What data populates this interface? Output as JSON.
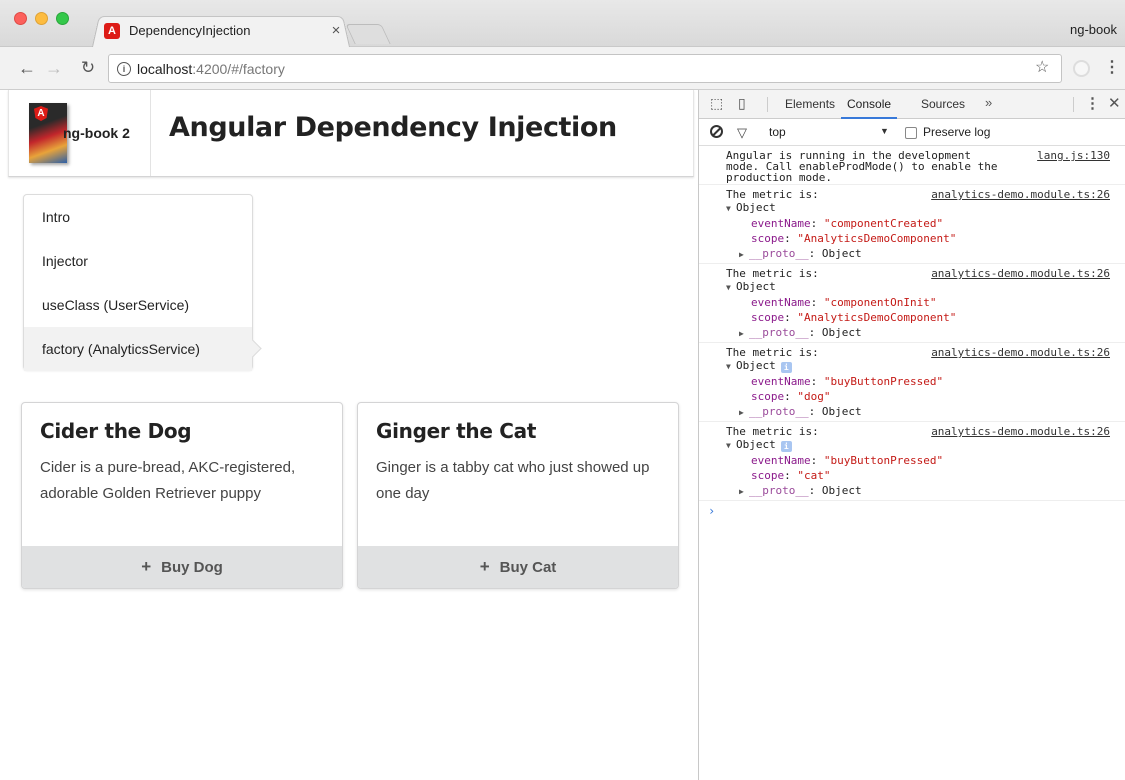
{
  "browser": {
    "tab_title": "DependencyInjection",
    "tab_close": "×",
    "profile": "ng-book",
    "url_host": "localhost",
    "url_path": ":4200/#/factory",
    "icons": {
      "back": "back-arrow-icon",
      "forward": "forward-arrow-icon",
      "reload": "reload-icon",
      "info": "info-icon",
      "star": "star-icon",
      "menu": "kebab-menu-icon"
    }
  },
  "header": {
    "brand": "ng-book 2",
    "title": "Angular Dependency Injection"
  },
  "sidebar": {
    "items": [
      {
        "label": "Intro"
      },
      {
        "label": "Injector"
      },
      {
        "label": "useClass (UserService)"
      },
      {
        "label": "factory (AnalyticsService)"
      }
    ],
    "active_index": 3
  },
  "cards": [
    {
      "title": "Cider the Dog",
      "description": "Cider is a pure-bread, AKC-registered, adorable Golden Retriever puppy",
      "button": "Buy Dog"
    },
    {
      "title": "Ginger the Cat",
      "description": "Ginger is a tabby cat who just showed up one day",
      "button": "Buy Cat"
    }
  ],
  "devtools": {
    "tabs": [
      "Elements",
      "Console",
      "Sources"
    ],
    "active_tab": "Console",
    "more": "»",
    "context": "top",
    "preserve_log": "Preserve log",
    "messages": [
      {
        "text": "Angular is running in the development mode. Call enableProdMode() to enable the production mode.",
        "source": "lang.js:130"
      },
      {
        "text": "The metric is:",
        "source": "analytics-demo.module.ts:26",
        "object": "Object",
        "props": [
          {
            "key": "eventName",
            "value": "\"componentCreated\""
          },
          {
            "key": "scope",
            "value": "\"AnalyticsDemoComponent\""
          }
        ],
        "proto": "__proto__",
        "proto_value": "Object"
      },
      {
        "text": "The metric is:",
        "source": "analytics-demo.module.ts:26",
        "object": "Object",
        "props": [
          {
            "key": "eventName",
            "value": "\"componentOnInit\""
          },
          {
            "key": "scope",
            "value": "\"AnalyticsDemoComponent\""
          }
        ],
        "proto": "__proto__",
        "proto_value": "Object"
      },
      {
        "text": "The metric is:",
        "source": "analytics-demo.module.ts:26",
        "object": "Object",
        "props": [
          {
            "key": "eventName",
            "value": "\"buyButtonPressed\""
          },
          {
            "key": "scope",
            "value": "\"dog\""
          }
        ],
        "proto": "__proto__",
        "proto_value": "Object"
      },
      {
        "text": "The metric is:",
        "source": "analytics-demo.module.ts:26",
        "object": "Object",
        "props": [
          {
            "key": "eventName",
            "value": "\"buyButtonPressed\""
          },
          {
            "key": "scope",
            "value": "\"cat\""
          }
        ],
        "proto": "__proto__",
        "proto_value": "Object"
      }
    ],
    "prompt": "›"
  }
}
